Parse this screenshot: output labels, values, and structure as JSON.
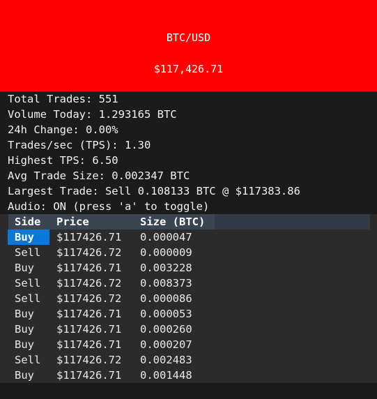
{
  "banner": {
    "pair": "BTC/USD",
    "price": "$117,426.71",
    "color": "#ff0000"
  },
  "stats": [
    "Total Trades: 551",
    "Volume Today: 1.293165 BTC",
    "24h Change: 0.00%",
    "Trades/sec (TPS): 1.30",
    "Highest TPS: 6.50",
    "Avg Trade Size: 0.002347 BTC",
    "Largest Trade: Sell 0.108133 BTC @ $117383.86",
    "Audio: ON (press 'a' to toggle)"
  ],
  "table": {
    "headers": [
      "Side",
      "Price",
      "Size (BTC)"
    ],
    "rows": [
      {
        "side": "Buy",
        "price": "$117426.71",
        "size": "0.000047",
        "selected": true
      },
      {
        "side": "Sell",
        "price": "$117426.72",
        "size": "0.000009"
      },
      {
        "side": "Buy",
        "price": "$117426.71",
        "size": "0.003228"
      },
      {
        "side": "Sell",
        "price": "$117426.72",
        "size": "0.008373"
      },
      {
        "side": "Sell",
        "price": "$117426.72",
        "size": "0.000086"
      },
      {
        "side": "Buy",
        "price": "$117426.71",
        "size": "0.000053"
      },
      {
        "side": "Buy",
        "price": "$117426.71",
        "size": "0.000260"
      },
      {
        "side": "Buy",
        "price": "$117426.71",
        "size": "0.000207"
      },
      {
        "side": "Sell",
        "price": "$117426.72",
        "size": "0.002483"
      },
      {
        "side": "Buy",
        "price": "$117426.71",
        "size": "0.001448"
      }
    ],
    "selected_color": "#0a78d7"
  }
}
